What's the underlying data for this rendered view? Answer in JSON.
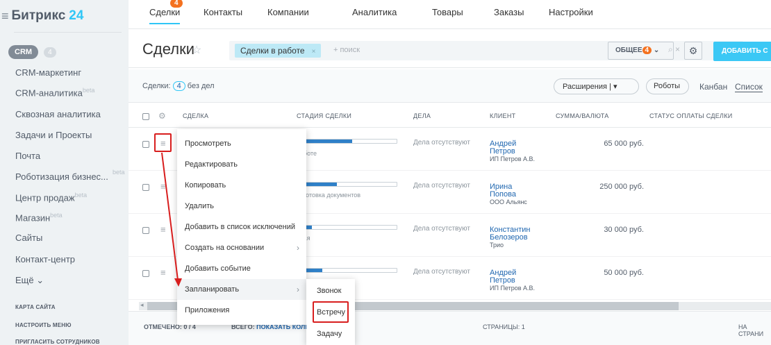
{
  "logo": {
    "burger": "≡",
    "brand": "Битрикс",
    "num": "24"
  },
  "sidebar": {
    "crm_label": "CRM",
    "crm_count": "4",
    "items": [
      {
        "label": "CRM-маркетинг",
        "beta": ""
      },
      {
        "label": "CRM-аналитика",
        "beta": "beta"
      },
      {
        "label": "Сквозная аналитика",
        "beta": ""
      },
      {
        "label": "Задачи и Проекты",
        "beta": ""
      },
      {
        "label": "Почта",
        "beta": ""
      },
      {
        "label": "Роботизация бизнес...",
        "beta": "beta"
      },
      {
        "label": "Центр продаж",
        "beta": "beta"
      },
      {
        "label": "Магазин",
        "beta": "beta"
      },
      {
        "label": "Сайты",
        "beta": ""
      },
      {
        "label": "Контакт-центр",
        "beta": ""
      },
      {
        "label": "Ещё",
        "beta": ""
      }
    ],
    "more_arrow": "⌄",
    "links": [
      "КАРТА САЙТА",
      "НАСТРОИТЬ МЕНЮ",
      "ПРИГЛАСИТЬ СОТРУДНИКОВ"
    ]
  },
  "topnav": {
    "tabs": [
      "Сделки",
      "Контакты",
      "Компании",
      "Аналитика",
      "Товары",
      "Заказы",
      "Настройки"
    ],
    "badge": "4"
  },
  "title": {
    "text": "Сделки",
    "star": "☆",
    "filter_chip": "Сделки в работе",
    "chip_close": "×",
    "search_placeholder": "+ поиск",
    "search_icons": "⌕ ×",
    "general_label": "ОБЩЕЕ",
    "general_badge": "4",
    "general_arrow": "⌄",
    "gear": "⚙",
    "add_label": "ДОБАВИТЬ С"
  },
  "subbar": {
    "deals_label": "Сделки:",
    "deals_count": "4",
    "deals_suffix": "без дел",
    "extensions": "Расширения",
    "ext_arrow": "| ▾",
    "robots": "Роботы",
    "views": [
      "Канбан",
      "Список"
    ]
  },
  "table": {
    "headers": [
      "СДЕЛКА",
      "СТАДИЯ СДЕЛКИ",
      "ДЕЛА",
      "КЛИЕНТ",
      "СУММА/ВАЛЮТА",
      "СТАТУС ОПЛАТЫ СДЕЛКИ"
    ],
    "gear": "⚙",
    "row_menu_icon": "≡",
    "rows": [
      {
        "stage": "работе",
        "progress": 0.55,
        "deals": "Дела отсутствуют",
        "client_first": "Андрей",
        "client_last": "Петров",
        "company": "ИП Петров А.В.",
        "sum": "65 000 руб."
      },
      {
        "stage": "одготовка документов",
        "progress": 0.4,
        "deals": "Дела отсутствуют",
        "client_first": "Ирина",
        "client_last": "Попова",
        "company": "ООО Альянс",
        "sum": "250 000 руб."
      },
      {
        "stage": "овая",
        "progress": 0.15,
        "deals": "Дела отсутствуют",
        "client_first": "Константин",
        "client_last": "Белозеров",
        "company": "Трио",
        "sum": "30 000 руб."
      },
      {
        "stage": "ту",
        "progress": 0.25,
        "deals": "Дела отсутствуют",
        "client_first": "Андрей",
        "client_last": "Петров",
        "company": "ИП Петров А.В.",
        "sum": "50 000 руб."
      }
    ]
  },
  "scroll": {
    "left_arrow": "◂"
  },
  "footer": {
    "selected_label": "ОТМЕЧЕНО:",
    "selected_value": "0 / 4",
    "total_label": "ВСЕГО:",
    "total_link": "ПОКАЗАТЬ КОЛИЧ",
    "pages_label": "СТРАНИЦЫ: 1",
    "per_page": "НА СТРАНИ"
  },
  "context_menu": {
    "items": [
      "Просмотреть",
      "Редактировать",
      "Копировать",
      "Удалить",
      "Добавить в список исключений",
      "Создать на основании",
      "Добавить событие",
      "Запланировать",
      "Приложения"
    ],
    "submenu_arrow": "›"
  },
  "submenu": {
    "items": [
      "Звонок",
      "Встречу",
      "Задачу"
    ]
  },
  "colors": {
    "accent": "#2fc6f6",
    "badge": "#f4711f",
    "link": "#2067b0",
    "highlight": "#d81e1e"
  }
}
